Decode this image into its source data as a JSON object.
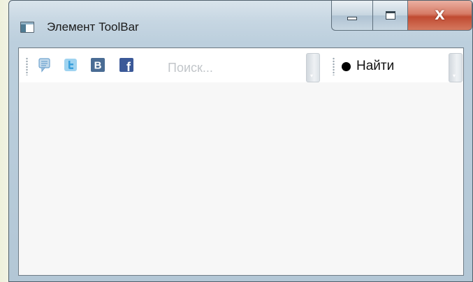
{
  "window": {
    "title": "Элемент ToolBar",
    "close_symbol": "X",
    "icon": "app-window-icon"
  },
  "toolbar": {
    "icons": [
      {
        "name": "comment-icon",
        "color": "#6fa3cf"
      },
      {
        "name": "twitter-icon",
        "color": "#3aa0dc"
      },
      {
        "name": "vk-icon",
        "label": "B",
        "color": "#4a6c94"
      },
      {
        "name": "facebook-icon",
        "label": "f",
        "color": "#3b5998"
      }
    ],
    "search_placeholder": "Поиск...",
    "search_value": "",
    "find_label": "Найти"
  }
}
